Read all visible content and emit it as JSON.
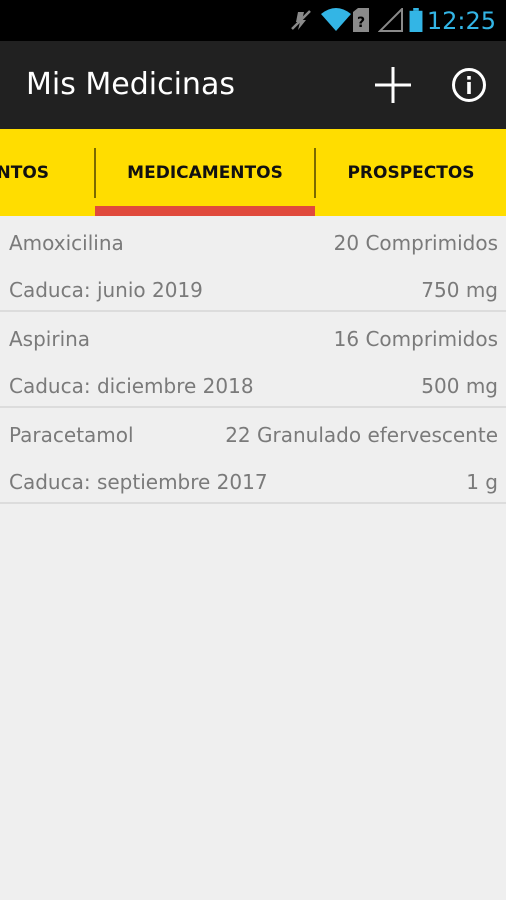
{
  "status_bar": {
    "time": "12:25",
    "icons": [
      "mute-icon",
      "wifi-icon",
      "no-sim-icon",
      "signal-icon",
      "battery-icon"
    ]
  },
  "action_bar": {
    "title": "Mis Medicinas",
    "actions": [
      "add-icon",
      "info-icon"
    ]
  },
  "tabs": [
    {
      "label": "ENTOS"
    },
    {
      "label": "MEDICAMENTOS",
      "selected": true
    },
    {
      "label": "PROSPECTOS"
    }
  ],
  "medicines": [
    {
      "name": "Amoxicilina",
      "quantity": "20 Comprimidos",
      "expiry": "Caduca: junio 2019",
      "dose": "750 mg"
    },
    {
      "name": "Aspirina",
      "quantity": "16 Comprimidos",
      "expiry": "Caduca: diciembre 2018",
      "dose": "500 mg"
    },
    {
      "name": "Paracetamol",
      "quantity": "22 Granulado efervescente",
      "expiry": "Caduca: septiembre 2017",
      "dose": "1 g"
    }
  ],
  "colors": {
    "status_time": "#33b5e5",
    "action_bar": "#212121",
    "tab_bar": "#ffdd00",
    "tab_indicator": "#e04a3c",
    "background": "#efefef"
  }
}
